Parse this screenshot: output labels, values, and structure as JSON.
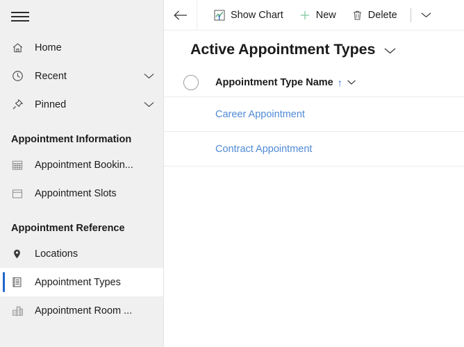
{
  "colors": {
    "accent": "#2266cc",
    "link": "#4f8ad6",
    "sidebar_bg": "#f0f0f0",
    "new_icon": "#7ec8a0",
    "text": "#1b1b1b"
  },
  "sidebar": {
    "menu_button": "site-map-hamburger",
    "items": [
      {
        "label": "Home",
        "icon": "home-icon",
        "type": "link",
        "chevron": false,
        "selected": false
      },
      {
        "label": "Recent",
        "icon": "clock-icon",
        "type": "link",
        "chevron": true,
        "selected": false
      },
      {
        "label": "Pinned",
        "icon": "pin-icon",
        "type": "link",
        "chevron": true,
        "selected": false
      }
    ],
    "groups": [
      {
        "header": "Appointment Information",
        "items": [
          {
            "label": "Appointment Bookin...",
            "icon": "calendar-grid-icon",
            "selected": false
          },
          {
            "label": "Appointment Slots",
            "icon": "calendar-icon",
            "selected": false
          }
        ]
      },
      {
        "header": "Appointment Reference",
        "items": [
          {
            "label": "Locations",
            "icon": "map-pin-icon",
            "selected": false
          },
          {
            "label": "Appointment Types",
            "icon": "list-doc-icon",
            "selected": true
          },
          {
            "label": "Appointment Room ...",
            "icon": "building-icon",
            "selected": false
          }
        ]
      }
    ]
  },
  "commandbar": {
    "back_label": "back-arrow",
    "buttons": [
      {
        "label": "Show Chart",
        "icon": "chart-icon"
      },
      {
        "label": "New",
        "icon": "plus-icon"
      },
      {
        "label": "Delete",
        "icon": "trash-icon"
      }
    ],
    "overflow_label": "more-commands-chevron"
  },
  "view": {
    "title": "Active Appointment Types",
    "title_chevron": "view-selector-chevron"
  },
  "grid": {
    "select_all": "select-all-circle",
    "columns": [
      {
        "label": "Appointment Type Name",
        "sort": "↑",
        "chevron": true
      }
    ],
    "rows": [
      {
        "name": "Career Appointment"
      },
      {
        "name": "Contract Appointment"
      }
    ]
  }
}
